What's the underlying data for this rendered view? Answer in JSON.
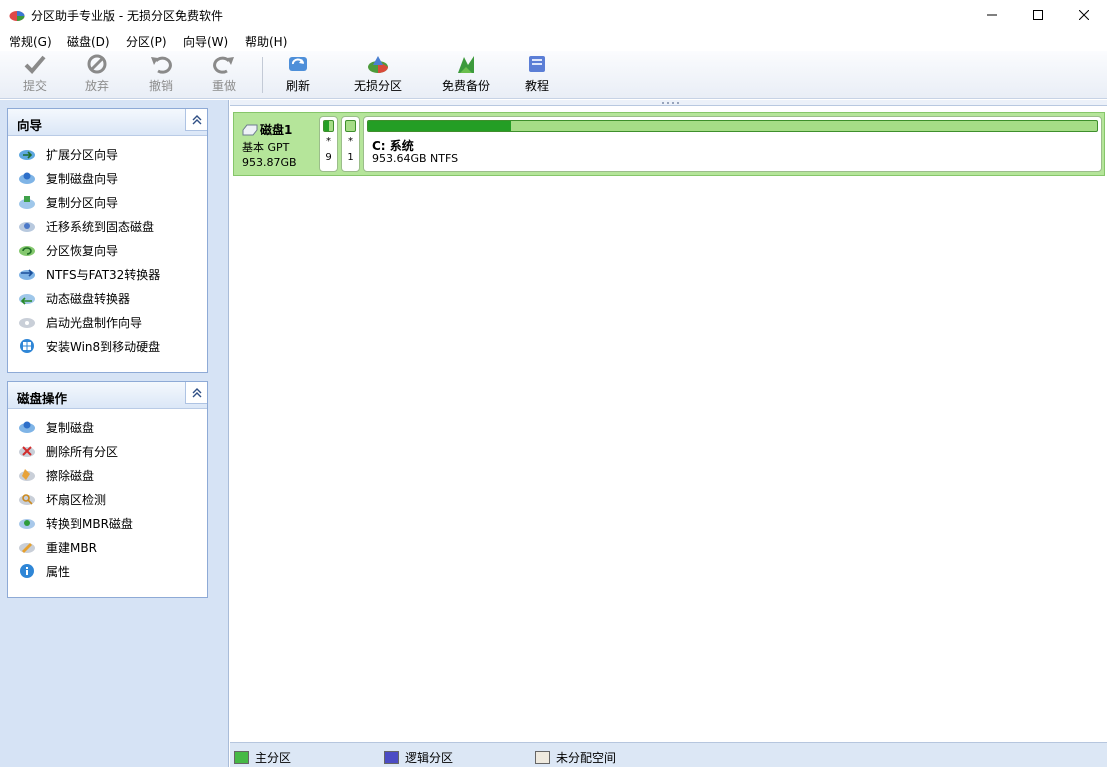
{
  "window": {
    "title": "分区助手专业版 - 无损分区免费软件"
  },
  "menu": [
    {
      "label": "常规(G)"
    },
    {
      "label": "磁盘(D)"
    },
    {
      "label": "分区(P)"
    },
    {
      "label": "向导(W)"
    },
    {
      "label": "帮助(H)"
    }
  ],
  "toolbar": {
    "commit": "提交",
    "discard": "放弃",
    "undo": "撤销",
    "redo": "重做",
    "refresh": "刷新",
    "lossless_partition": "无损分区",
    "free_backup": "免费备份",
    "tutorial": "教程"
  },
  "wizard_panel": {
    "title": "向导",
    "items": [
      {
        "label": "扩展分区向导"
      },
      {
        "label": "复制磁盘向导"
      },
      {
        "label": "复制分区向导"
      },
      {
        "label": "迁移系统到固态磁盘"
      },
      {
        "label": "分区恢复向导"
      },
      {
        "label": "NTFS与FAT32转换器"
      },
      {
        "label": "动态磁盘转换器"
      },
      {
        "label": "启动光盘制作向导"
      },
      {
        "label": "安装Win8到移动硬盘"
      }
    ]
  },
  "disk_ops_panel": {
    "title": "磁盘操作",
    "items": [
      {
        "label": "复制磁盘"
      },
      {
        "label": "删除所有分区"
      },
      {
        "label": "擦除磁盘"
      },
      {
        "label": "坏扇区检测"
      },
      {
        "label": "转换到MBR磁盘"
      },
      {
        "label": "重建MBR"
      },
      {
        "label": "属性"
      }
    ]
  },
  "disk": {
    "name": "磁盘1",
    "type": "基本 GPT",
    "size": "953.87GB",
    "partitions": [
      {
        "star": "*",
        "num": "9",
        "used_fraction": 0.55
      },
      {
        "star": "*",
        "num": "1",
        "used_fraction": 0.0
      },
      {
        "name": "C: 系统",
        "detail": "953.64GB NTFS",
        "used_fraction": 0.196
      }
    ]
  },
  "legend": {
    "primary": "主分区",
    "logical": "逻辑分区",
    "unallocated": "未分配空间"
  },
  "colors": {
    "primary_swatch": "#46b946",
    "logical_swatch": "#4c4cc4",
    "unallocated_swatch": "#efeadf",
    "disk_bg": "#b5e59a",
    "used_fill": "#249e25"
  }
}
